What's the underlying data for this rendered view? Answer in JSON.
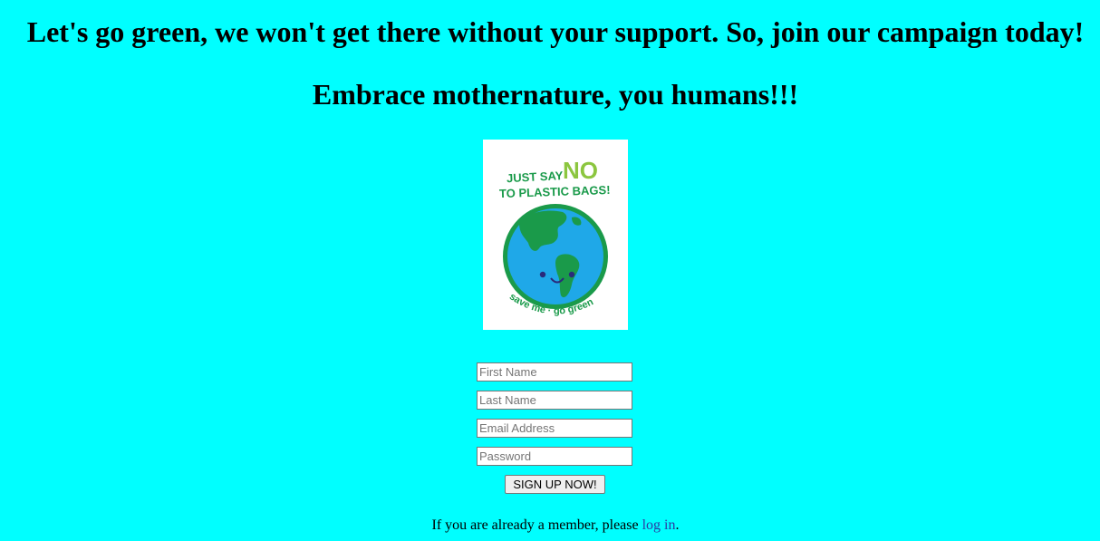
{
  "page": {
    "headline": "Let's go green, we won't get there without your support. So, join our campaign today!",
    "subheadline": "Embrace mothernature, you humans!!!"
  },
  "poster": {
    "text_line1_a": "JUST SAY",
    "text_line1_b": "NO",
    "text_line2": "TO PLASTIC BAGS!",
    "text_bottom": "save me · go green"
  },
  "form": {
    "first_name": {
      "placeholder": "First Name",
      "value": ""
    },
    "last_name": {
      "placeholder": "Last Name",
      "value": ""
    },
    "email": {
      "placeholder": "Email Address",
      "value": ""
    },
    "password": {
      "placeholder": "Password",
      "value": ""
    },
    "submit_label": "SIGN UP NOW!"
  },
  "login": {
    "prefix": "If you are already a member, please ",
    "link_text": "log in",
    "suffix": "."
  },
  "colors": {
    "background": "#00ffff",
    "poster_green_dark": "#1a9a4a",
    "poster_green_light": "#8cc63f",
    "ocean_blue": "#1fa8e8",
    "link": "#2c3ba3"
  }
}
